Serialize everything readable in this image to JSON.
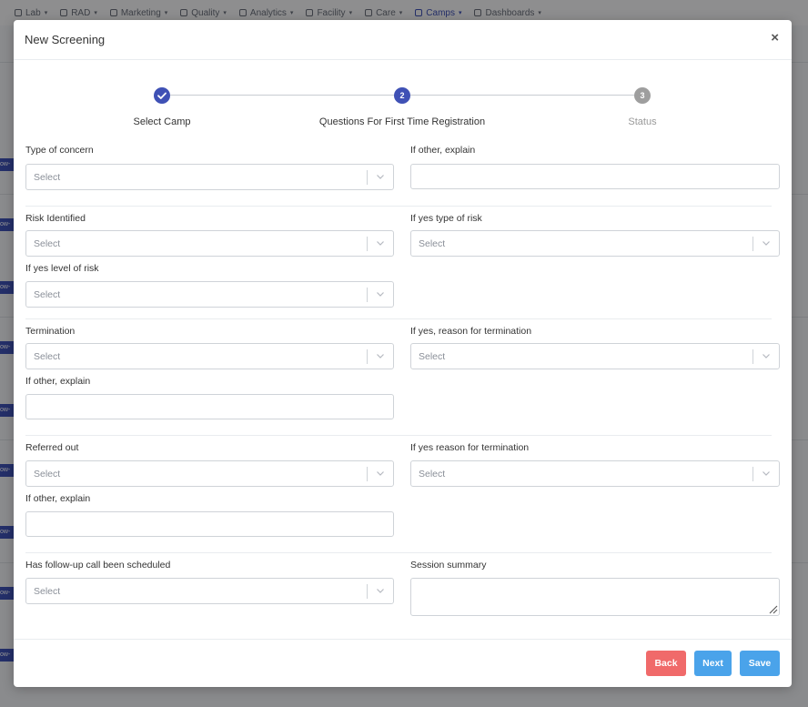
{
  "nav": {
    "items": [
      {
        "label": "Lab",
        "icon": "flask-icon"
      },
      {
        "label": "RAD",
        "icon": "folder-icon"
      },
      {
        "label": "Marketing",
        "icon": "briefcase-icon"
      },
      {
        "label": "Quality",
        "icon": "board-icon"
      },
      {
        "label": "Analytics",
        "icon": "pulse-icon"
      },
      {
        "label": "Facility",
        "icon": "building-icon"
      },
      {
        "label": "Care",
        "icon": "car-icon"
      },
      {
        "label": "Camps",
        "icon": "tent-icon",
        "active": true
      },
      {
        "label": "Dashboards",
        "icon": "grid-icon"
      }
    ],
    "row_tag": "ow-"
  },
  "modal": {
    "title": "New Screening",
    "close_label": "×"
  },
  "stepper": {
    "steps": [
      {
        "number": "",
        "label": "Select Camp",
        "state": "done"
      },
      {
        "number": "2",
        "label": "Questions For First Time Registration",
        "state": "active"
      },
      {
        "number": "3",
        "label": "Status",
        "state": "pending"
      }
    ]
  },
  "form": {
    "placeholder": "Select",
    "type_of_concern_label": "Type of concern",
    "if_other_explain_1_label": "If other, explain",
    "risk_identified_label": "Risk Identified",
    "if_yes_type_of_risk_label": "If yes type of risk",
    "if_yes_level_of_risk_label": "If yes level of risk",
    "termination_label": "Termination",
    "if_yes_reason_termination_label": "If yes, reason for termination",
    "if_other_explain_2_label": "If other, explain",
    "referred_out_label": "Referred out",
    "if_yes_reason_termination_2_label": "If yes reason for termination",
    "if_other_explain_3_label": "If other, explain",
    "follow_up_label": "Has follow-up call been scheduled",
    "session_summary_label": "Session summary"
  },
  "footer": {
    "back_label": "Back",
    "next_label": "Next",
    "save_label": "Save"
  },
  "colors": {
    "primary": "#3f51b5",
    "back": "#f06a6a",
    "next": "#4aa3ea",
    "save": "#4aa3ea",
    "pending": "#9e9e9e"
  }
}
